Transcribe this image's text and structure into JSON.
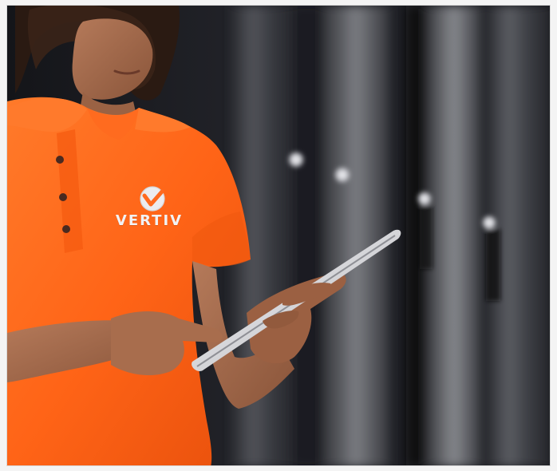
{
  "photo": {
    "subject": "person-with-tablet",
    "setting": "data-center-server-racks",
    "shirt_color": "#ff6a1f",
    "background_color": "#0b0c0f"
  },
  "logo": {
    "text": "VERTIV",
    "icon": "vertiv-v-checkmark-icon"
  }
}
